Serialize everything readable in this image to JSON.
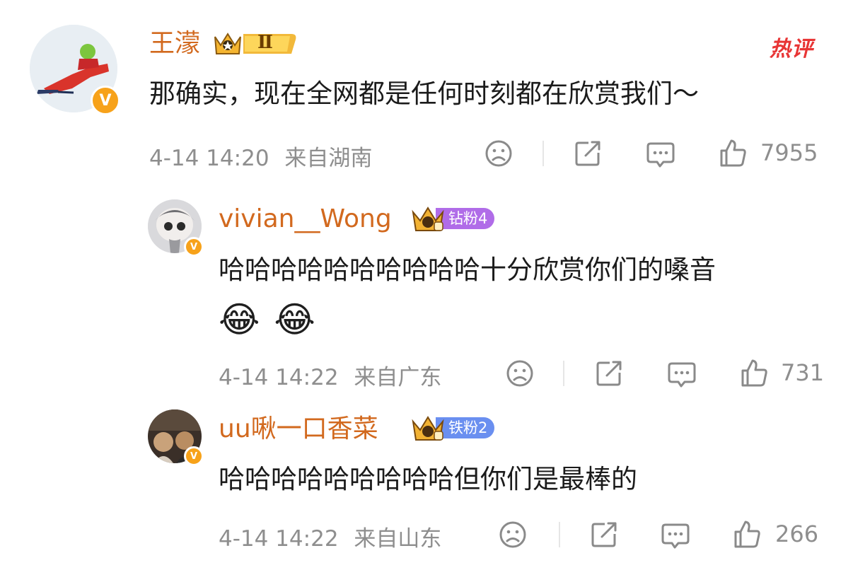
{
  "comments": [
    {
      "user": "王濛",
      "text": "那确实，现在全网都是任何时刻都在欣赏我们～",
      "time": "4-14 14:20",
      "location": "来自湖南",
      "likes": "7955",
      "level_badge": "Ⅱ",
      "hot_tag": "热评"
    },
    {
      "user": "vivian__Wong",
      "text": "哈哈哈哈哈哈哈哈哈哈十分欣赏你们的嗓音",
      "emoji": [
        "😂",
        "😂"
      ],
      "time": "4-14 14:22",
      "location": "来自广东",
      "likes": "731",
      "fan_badge": "钻粉4",
      "fan_badge_color": "#b06ce8"
    },
    {
      "user": "uu啾一口香菜",
      "text": "哈哈哈哈哈哈哈哈哈但你们是最棒的",
      "time": "4-14 14:22",
      "location": "来自山东",
      "likes": "266",
      "fan_badge": "铁粉2",
      "fan_badge_color": "#6a8ff0"
    }
  ],
  "icons": {
    "emoji_react": "sad-face-icon",
    "share": "share-icon",
    "comment": "comment-icon",
    "like": "thumbs-up-icon",
    "verified": "verified-v-icon"
  },
  "colors": {
    "username": "#d2691e",
    "meta": "#8e8e8e",
    "verified": "#f7a21a",
    "hot": "#e83535"
  }
}
